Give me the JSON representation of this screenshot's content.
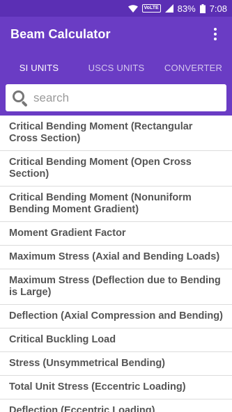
{
  "status_bar": {
    "wifi_icon": "wifi-icon",
    "volte_label": "VoLTE",
    "signal_icon": "cell-signal-icon",
    "battery_percent": "83%",
    "battery_icon": "battery-icon",
    "time": "7:08"
  },
  "app_bar": {
    "title": "Beam Calculator",
    "menu_icon": "more-vert-icon"
  },
  "tabs": [
    {
      "label": "SI UNITS",
      "active": true
    },
    {
      "label": "USCS UNITS",
      "active": false
    },
    {
      "label": "CONVERTER",
      "active": false
    }
  ],
  "search": {
    "placeholder": "search",
    "value": ""
  },
  "list": [
    {
      "label": "Critical Bending Moment (Rectangular Cross Section)"
    },
    {
      "label": "Critical Bending Moment (Open Cross Section)"
    },
    {
      "label": "Critical Bending Moment (Nonuniform Bending Moment Gradient)"
    },
    {
      "label": "Moment Gradient Factor"
    },
    {
      "label": "Maximum Stress (Axial and Bending Loads)"
    },
    {
      "label": "Maximum Stress (Deflection due to Bending is Large)"
    },
    {
      "label": "Deflection (Axial Compression and Bending)"
    },
    {
      "label": "Critical Buckling Load"
    },
    {
      "label": "Stress (Unsymmetrical Bending)"
    },
    {
      "label": "Total Unit Stress (Eccentric Loading)"
    },
    {
      "label": "Deflection (Eccentric Loading)"
    }
  ],
  "colors": {
    "status_bar": "#5b2fb4",
    "app_bar": "#6a3cc4",
    "list_text": "#555555"
  }
}
